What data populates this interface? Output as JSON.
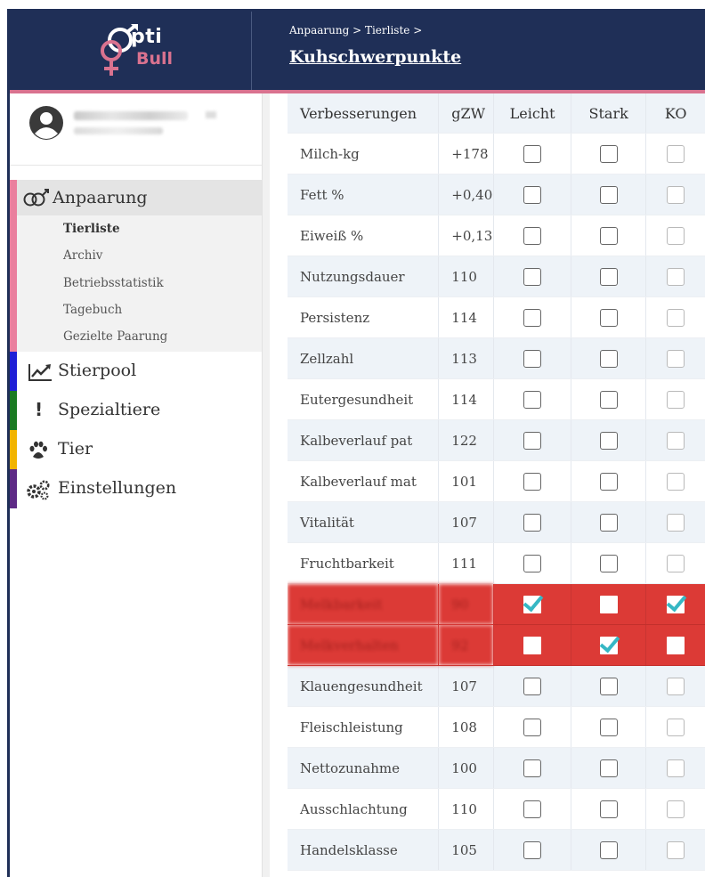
{
  "header": {
    "logo_top": "pti",
    "logo_bottom": "Bull",
    "breadcrumb": "Anpaarung > Tierliste >",
    "title": "Kuhschwerpunkte"
  },
  "sidebar": {
    "user_name": "",
    "sections": [
      {
        "label": "Anpaarung",
        "color": "#ea7f9e",
        "icon": "gender-rings-icon"
      },
      {
        "label": "Stierpool",
        "color": "#1f1fd6",
        "icon": "trend-chart-icon"
      },
      {
        "label": "Spezialtiere",
        "color": "#1a7a22",
        "icon": "exclamation-icon"
      },
      {
        "label": "Tier",
        "color": "#f2b400",
        "icon": "paw-icon"
      },
      {
        "label": "Einstellungen",
        "color": "#5e2a86",
        "icon": "gears-icon"
      }
    ],
    "sub_items": [
      "Tierliste",
      "Archiv",
      "Betriebsstatistik",
      "Tagebuch",
      "Gezielte Paarung"
    ]
  },
  "table": {
    "headers": [
      "Verbesserungen",
      "gZW",
      "Leicht",
      "Stark",
      "KO"
    ],
    "rows": [
      {
        "name": "Milch-kg",
        "gzw": "+178",
        "leicht": false,
        "stark": false,
        "ko": false,
        "flag": false
      },
      {
        "name": "Fett %",
        "gzw": "+0,40",
        "leicht": false,
        "stark": false,
        "ko": false,
        "flag": false
      },
      {
        "name": "Eiweiß %",
        "gzw": "+0,13",
        "leicht": false,
        "stark": false,
        "ko": false,
        "flag": false
      },
      {
        "name": "Nutzungsdauer",
        "gzw": "110",
        "leicht": false,
        "stark": false,
        "ko": false,
        "flag": false
      },
      {
        "name": "Persistenz",
        "gzw": "114",
        "leicht": false,
        "stark": false,
        "ko": false,
        "flag": false
      },
      {
        "name": "Zellzahl",
        "gzw": "113",
        "leicht": false,
        "stark": false,
        "ko": false,
        "flag": false
      },
      {
        "name": "Eutergesundheit",
        "gzw": "114",
        "leicht": false,
        "stark": false,
        "ko": false,
        "flag": false
      },
      {
        "name": "Kalbeverlauf pat",
        "gzw": "122",
        "leicht": false,
        "stark": false,
        "ko": false,
        "flag": false
      },
      {
        "name": "Kalbeverlauf mat",
        "gzw": "101",
        "leicht": false,
        "stark": false,
        "ko": false,
        "flag": false
      },
      {
        "name": "Vitalität",
        "gzw": "107",
        "leicht": false,
        "stark": false,
        "ko": false,
        "flag": false
      },
      {
        "name": "Fruchtbarkeit",
        "gzw": "111",
        "leicht": false,
        "stark": false,
        "ko": false,
        "flag": false
      },
      {
        "name": "Melkbarkeit",
        "gzw": "90",
        "leicht": true,
        "stark": false,
        "ko": true,
        "flag": true
      },
      {
        "name": "Melkverhalten",
        "gzw": "92",
        "leicht": false,
        "stark": true,
        "ko": false,
        "flag": true
      },
      {
        "name": "Klauengesundheit",
        "gzw": "107",
        "leicht": false,
        "stark": false,
        "ko": false,
        "flag": false
      },
      {
        "name": "Fleischleistung",
        "gzw": "108",
        "leicht": false,
        "stark": false,
        "ko": false,
        "flag": false
      },
      {
        "name": "Nettozunahme",
        "gzw": "100",
        "leicht": false,
        "stark": false,
        "ko": false,
        "flag": false
      },
      {
        "name": "Ausschlachtung",
        "gzw": "110",
        "leicht": false,
        "stark": false,
        "ko": false,
        "flag": false
      },
      {
        "name": "Handelsklasse",
        "gzw": "105",
        "leicht": false,
        "stark": false,
        "ko": false,
        "flag": false
      }
    ]
  }
}
